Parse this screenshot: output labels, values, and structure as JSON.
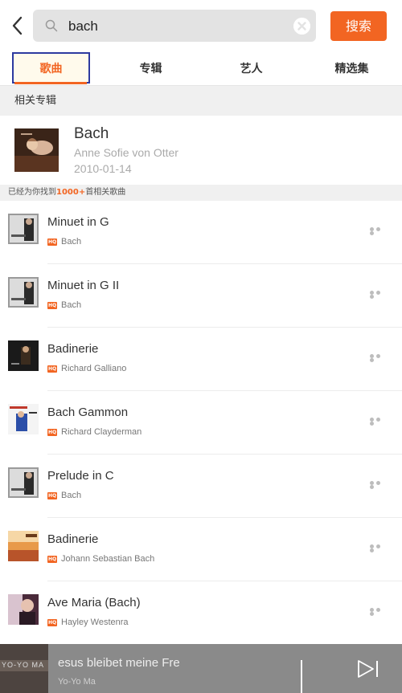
{
  "search": {
    "query": "bach",
    "button_label": "搜索"
  },
  "tabs": [
    {
      "label": "歌曲",
      "active": true
    },
    {
      "label": "专辑",
      "active": false
    },
    {
      "label": "艺人",
      "active": false
    },
    {
      "label": "精选集",
      "active": false
    }
  ],
  "related_albums": {
    "header": "相关专辑",
    "album": {
      "title": "Bach",
      "artist": "Anne Sofie von Otter",
      "date": "2010-01-14"
    }
  },
  "result_count": {
    "prefix": "已经为你找到",
    "count": "1000+",
    "suffix": "首相关歌曲"
  },
  "songs": [
    {
      "title": "Minuet in G",
      "artist": "Bach",
      "quality": "HQ"
    },
    {
      "title": "Minuet in G II",
      "artist": "Bach",
      "quality": "HQ"
    },
    {
      "title": "Badinerie",
      "artist": "Richard Galliano",
      "quality": "HQ"
    },
    {
      "title": "Bach Gammon",
      "artist": "Richard Clayderman",
      "quality": "HQ"
    },
    {
      "title": "Prelude in C",
      "artist": "Bach",
      "quality": "HQ"
    },
    {
      "title": "Badinerie",
      "artist": "Johann Sebastian Bach",
      "quality": "HQ"
    },
    {
      "title": "Ave Maria (Bach)",
      "artist": "Hayley Westenra",
      "quality": "HQ"
    }
  ],
  "player": {
    "title": "esus bleibet meine Fre",
    "artist": "Yo-Yo Ma",
    "cover_text": "YO-YO MA"
  },
  "colors": {
    "accent": "#f26522",
    "tab_highlight_border": "#2d3aa0"
  },
  "icons": {
    "back": "chevron-left-icon",
    "search": "search-icon",
    "clear": "clear-icon",
    "more": "more-dots-icon",
    "pause": "pause-icon",
    "next": "skip-next-icon"
  }
}
